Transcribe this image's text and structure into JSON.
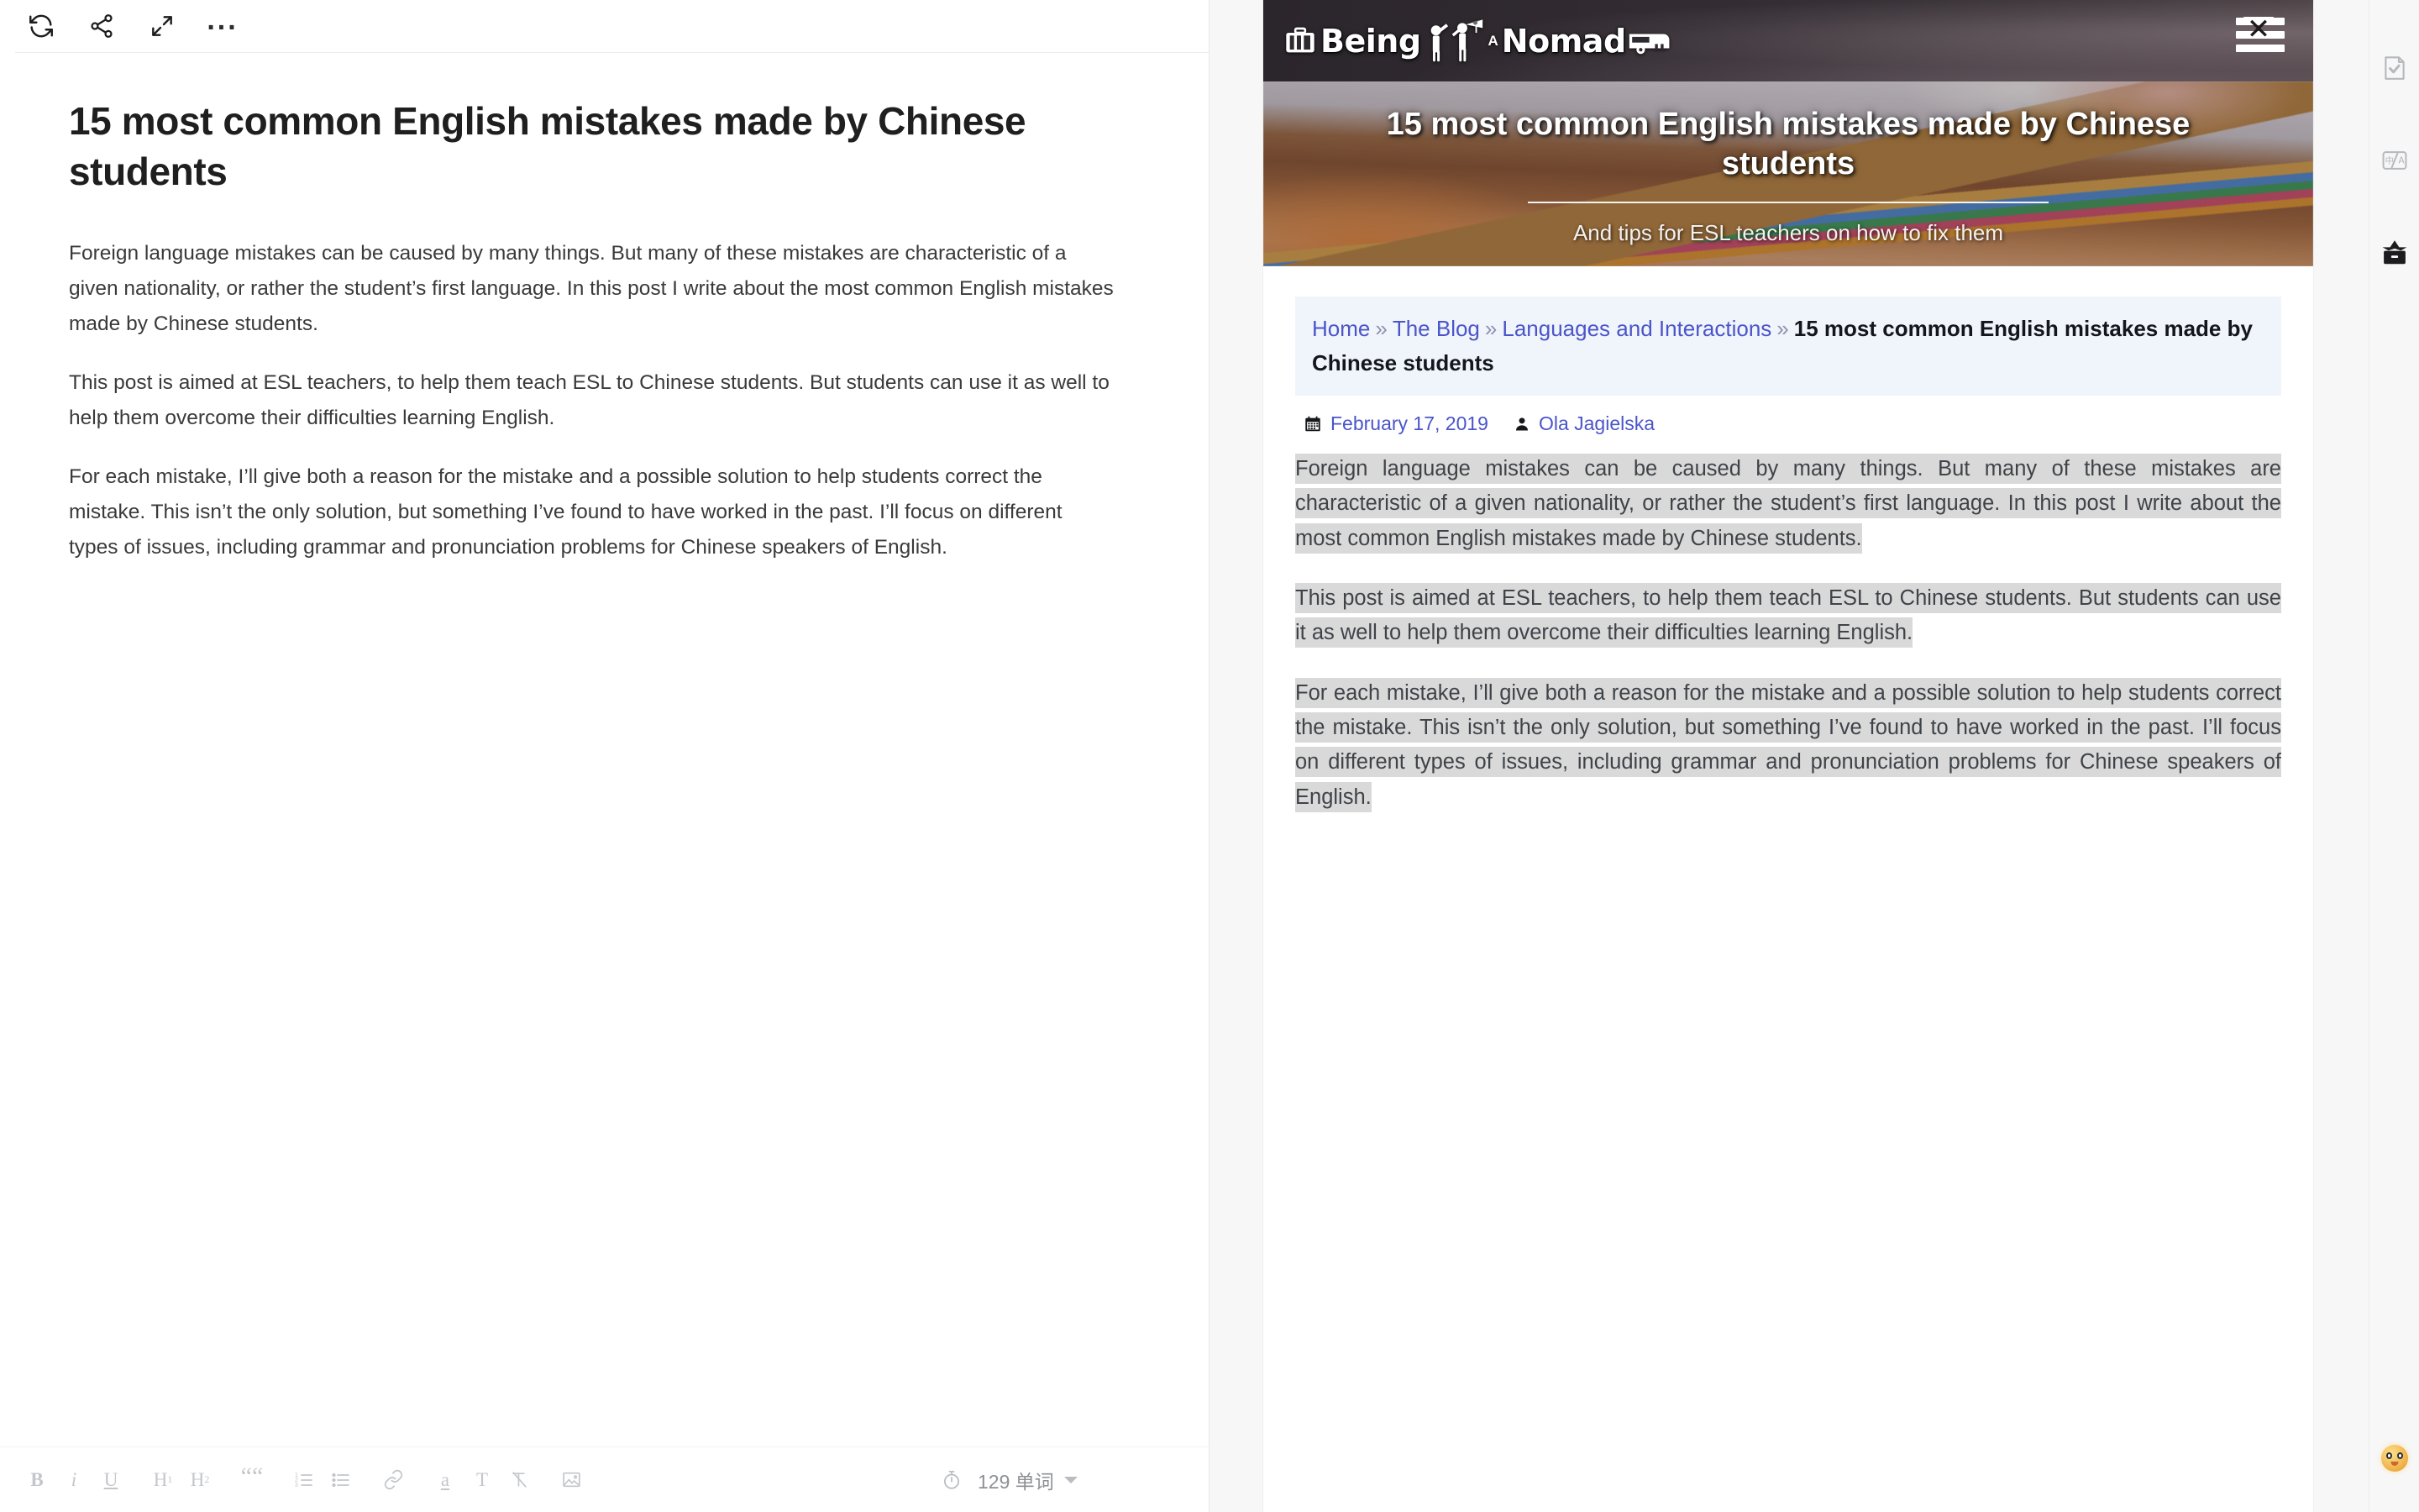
{
  "editor": {
    "toolbar": {
      "refresh_label": "Refresh",
      "share_label": "Share",
      "fullscreen_label": "Fullscreen",
      "more_label": "..."
    },
    "document": {
      "title": "15 most common English mistakes made by Chinese students",
      "paragraphs": [
        "Foreign language mistakes can be caused by many things. But many of these mistakes are characteristic of a given nationality, or rather the student’s first language. In this post I write about the most common English mistakes made by Chinese students.",
        "This post is aimed at ESL teachers, to help them teach ESL to Chinese students. But students can use it as well to help them overcome their difficulties learning English.",
        "For each mistake, I’ll give both a reason for the mistake and a possible solution to help students correct the mistake. This isn’t the only solution, but something I’ve found to have worked in the past. I’ll focus on different types of issues, including grammar and pronunciation problems for Chinese speakers of English."
      ]
    },
    "format_bar": {
      "bold": "B",
      "italic": "i",
      "underline": "U",
      "heading1": "H",
      "heading1_sub": "1",
      "heading2": "H",
      "heading2_sub": "2",
      "quote": "““",
      "ordered_list_label": "Ordered list",
      "unordered_list_label": "Bulleted list",
      "link_label": "Insert link",
      "highlight": "a",
      "text_color": "T",
      "clear_format_label": "Clear formatting",
      "image_label": "Insert image"
    },
    "status": {
      "word_count": "129 单词",
      "timer_label": "Reading time"
    }
  },
  "preview": {
    "site": {
      "logo_prefix": "Being",
      "logo_middle": "A",
      "logo_suffix": "Nomad",
      "menu_label": "Menu"
    },
    "hero": {
      "title": "15 most common English mistakes made by Chinese students",
      "subtitle": "And tips for ESL teachers on how to fix them"
    },
    "breadcrumb": {
      "items": [
        {
          "label": "Home",
          "link": true
        },
        {
          "label": "The Blog",
          "link": true
        },
        {
          "label": "Languages and Interactions",
          "link": true
        }
      ],
      "separator": "»",
      "current": "15 most common English mistakes made by Chinese students"
    },
    "meta": {
      "date": "February 17, 2019",
      "author": "Ola Jagielska",
      "calendar_icon": "calendar-icon",
      "author_icon": "user-icon"
    },
    "article": {
      "paragraphs": [
        "Foreign language mistakes can be caused by many things. But many of these mistakes are characteristic of a given nationality, or rather the student’s first language. In this post I write about the most common English mistakes made by Chinese students.",
        "This post is aimed at ESL teachers, to help them teach ESL to Chinese students. But students can use it as well to help them overcome their difficulties learning English.",
        "For each mistake, I’ll give both a reason for the mistake and a possible solution to help students correct the mistake. This isn’t the only solution, but something I’ve found to have worked in the past. I’ll focus on different types of issues, including grammar and pronunciation problems for Chinese speakers of English."
      ]
    }
  },
  "rail": {
    "items": [
      {
        "name": "check-document-icon",
        "label": "Proofread"
      },
      {
        "name": "translate-icon",
        "label": "Translate"
      },
      {
        "name": "archive-box-icon",
        "label": "Archive"
      }
    ],
    "emoji_label": "Feedback"
  },
  "colors": {
    "accent_link": "#4b55c9",
    "breadcrumb_bg": "#f0f4fb",
    "highlight": "#d9d9d9",
    "header_bg": "#2e2a30",
    "rail_bg": "#f7f7f7"
  }
}
